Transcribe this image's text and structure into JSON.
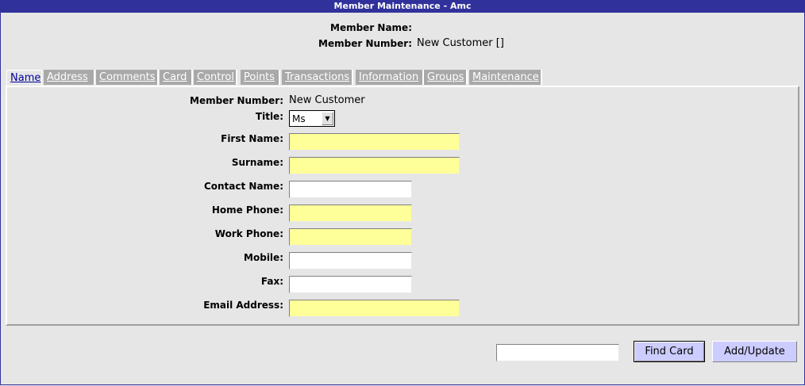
{
  "window": {
    "title": "Member Maintenance - Amc"
  },
  "header": {
    "member_name_label": "Member Name:",
    "member_name_value": "",
    "member_number_label": "Member Number:",
    "member_number_value": "New Customer []"
  },
  "tabs": [
    "Name",
    "Address",
    "Comments",
    "Card",
    "Control",
    "Points",
    "Transactions",
    "Information",
    "Groups",
    "Maintenance"
  ],
  "active_tab": "Name",
  "form": {
    "member_number": {
      "label": "Member Number:",
      "value": "New Customer"
    },
    "title": {
      "label": "Title:",
      "value": "Ms"
    },
    "first_name": {
      "label": "First Name:",
      "value": "",
      "required": true
    },
    "surname": {
      "label": "Surname:",
      "value": "",
      "required": true
    },
    "contact_name": {
      "label": "Contact Name:",
      "value": "",
      "required": false
    },
    "home_phone": {
      "label": "Home Phone:",
      "value": "",
      "required": true
    },
    "work_phone": {
      "label": "Work Phone:",
      "value": "",
      "required": true
    },
    "mobile": {
      "label": "Mobile:",
      "value": "",
      "required": false
    },
    "fax": {
      "label": "Fax:",
      "value": "",
      "required": false
    },
    "email": {
      "label": "Email Address:",
      "value": "",
      "required": true
    }
  },
  "footer": {
    "card_search_value": "",
    "find_card_label": "Find Card",
    "add_update_label": "Add/Update"
  },
  "colors": {
    "titlebar": "#31319c",
    "required_field": "#ffff99",
    "button": "#ccccff",
    "tab_inactive": "#a9a9a9"
  }
}
